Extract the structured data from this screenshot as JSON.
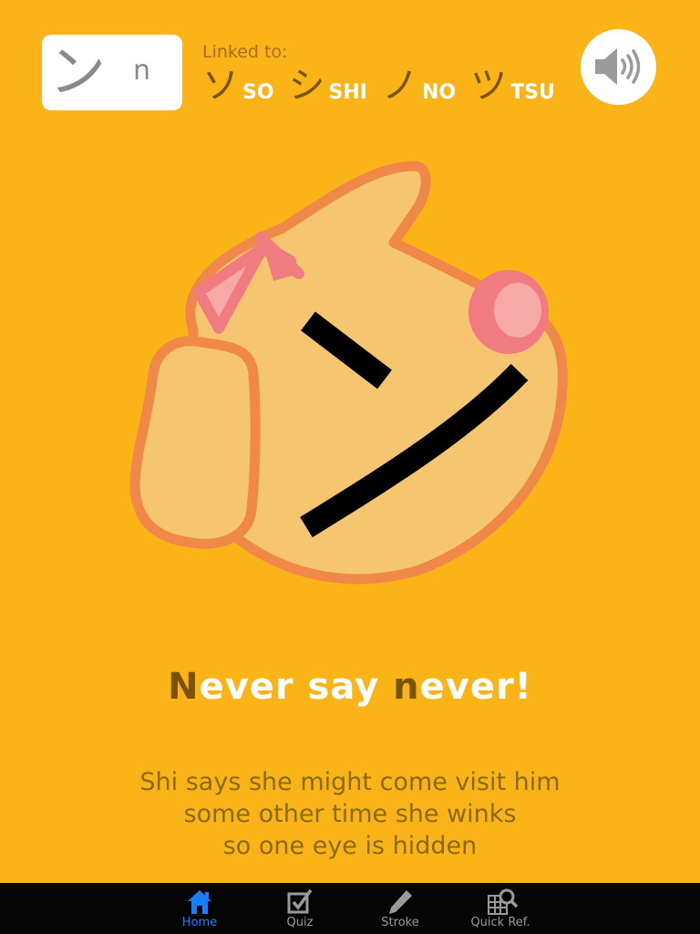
{
  "current_kana": {
    "kana": "ン",
    "romaji": "n"
  },
  "linked": {
    "label": "Linked to:",
    "items": [
      {
        "kana": "ソ",
        "romaji": "SO"
      },
      {
        "kana": "シ",
        "romaji": "SHI"
      },
      {
        "kana": "ノ",
        "romaji": "NO"
      },
      {
        "kana": "ツ",
        "romaji": "TSU"
      }
    ]
  },
  "sound_button": {
    "icon": "speaker-icon"
  },
  "mnemonic": {
    "headline_parts": [
      "N",
      "ever say ",
      "n",
      "ever!"
    ],
    "description_lines": [
      "Shi says she might come visit him",
      "some other time she winks",
      "so one eye is hidden"
    ]
  },
  "tabs": [
    {
      "label": "Home",
      "icon": "home-icon",
      "active": true
    },
    {
      "label": "Quiz",
      "icon": "checkbox-icon",
      "active": false
    },
    {
      "label": "Stroke",
      "icon": "pencil-icon",
      "active": false
    },
    {
      "label": "Quick Ref.",
      "icon": "grid-search-icon",
      "active": false
    }
  ],
  "colors": {
    "background": "#FBB417",
    "face_fill": "#F6C56F",
    "face_outline": "#F0884A",
    "bow": "#F07B80",
    "highlight_text": "#7A5200",
    "tab_active": "#1a7dff"
  }
}
